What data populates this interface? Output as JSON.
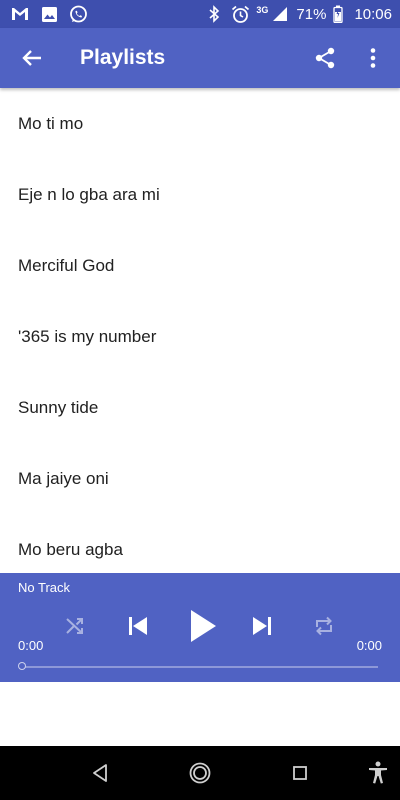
{
  "status_bar": {
    "signal": "3G",
    "battery_percent": "71%",
    "time": "10:06",
    "icons": [
      "gmail-icon",
      "gallery-icon",
      "whatsapp-icon",
      "bluetooth-icon",
      "alarm-icon",
      "signal-icon",
      "battery-icon"
    ]
  },
  "app_bar": {
    "title": "Playlists",
    "color": "#5062c3"
  },
  "songs": [
    "Mo ti mo",
    "Eje n lo gba ara mi",
    "Merciful God",
    "'365 is my number",
    "Sunny tide",
    "Ma jaiye oni",
    "Mo beru agba"
  ],
  "player": {
    "track": "No Track",
    "elapsed": "0:00",
    "duration": "0:00",
    "progress": 0
  }
}
